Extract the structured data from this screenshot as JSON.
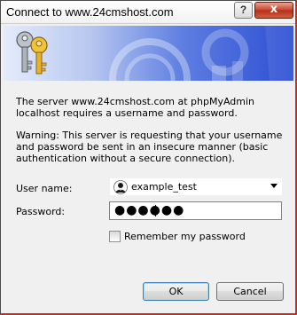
{
  "window": {
    "title": "Connect to www.24cmshost.com",
    "help_button": "?",
    "close_button": "x"
  },
  "message": {
    "server": "The server www.24cmshost.com at phpMyAdmin localhost requires a username and password.",
    "warning": "Warning: This server is requesting that your username and password be sent in an insecure manner (basic authentication without a secure connection)."
  },
  "form": {
    "username_label": "User name:",
    "username_value": "example_test",
    "password_label": "Password:",
    "password_masked": "●●●●●●",
    "remember_label": "Remember my password",
    "remember_checked": false
  },
  "buttons": {
    "ok": "OK",
    "cancel": "Cancel"
  },
  "icons": {
    "banner": "keys-icon",
    "user": "user-account-icon"
  },
  "colors": {
    "banner_start": "#e4ebfb",
    "banner_end": "#2d4ed3",
    "close_button": "#c8412a"
  }
}
